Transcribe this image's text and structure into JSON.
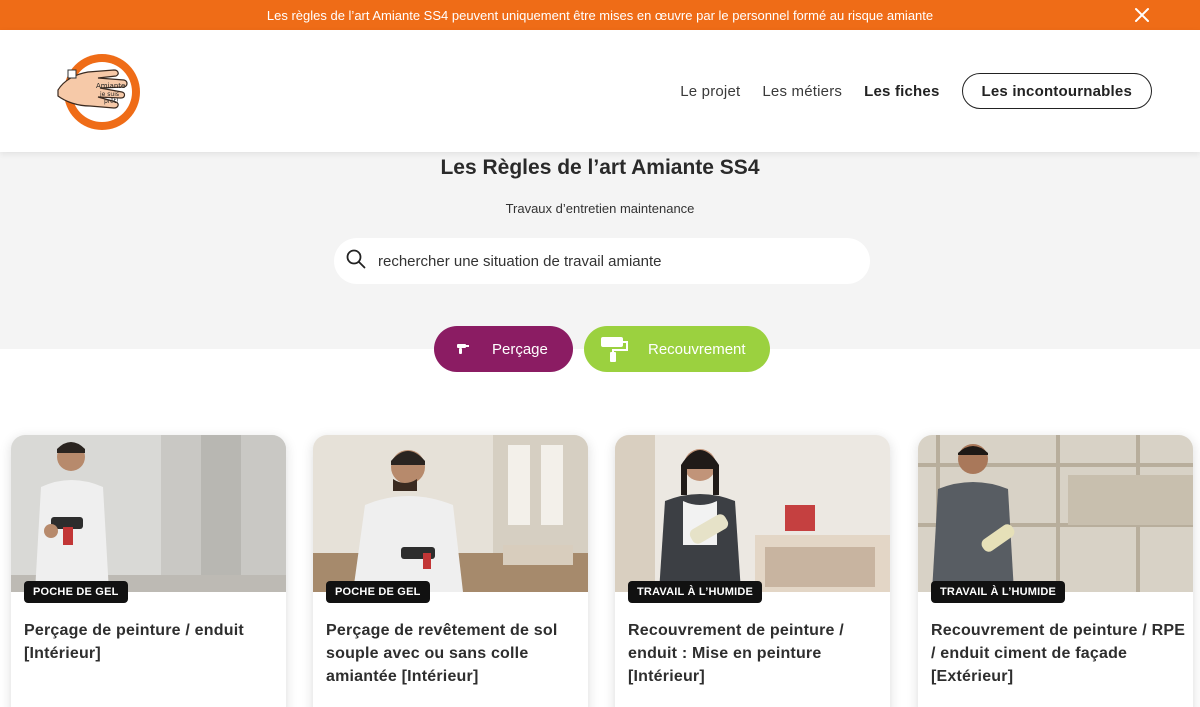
{
  "banner": {
    "text": "Les règles de l’art Amiante SS4 peuvent uniquement être mises en œuvre par le personnel formé au risque amiante",
    "close_icon": "close-icon",
    "color": "#ef6c17"
  },
  "header": {
    "logo_icon": "hand-logo-icon",
    "nav": {
      "projet": "Le projet",
      "metiers": "Les métiers",
      "fiches": "Les fiches",
      "incontournables": "Les incontournables"
    }
  },
  "hero": {
    "title": "Les Règles de l’art Amiante SS4",
    "subtitle": "Travaux d’entretien maintenance",
    "search_placeholder": "rechercher une situation de travail amiante",
    "search_icon": "search-icon"
  },
  "filters": [
    {
      "label": "Perçage",
      "icon": "drill-icon",
      "color": "#8b1c63"
    },
    {
      "label": "Recouvrement",
      "icon": "paint-roller-icon",
      "color": "#9bd13f"
    }
  ],
  "cards": [
    {
      "tag": "POCHE DE GEL",
      "title": "Perçage de peinture / enduit [Intérieur]"
    },
    {
      "tag": "POCHE DE GEL",
      "title": "Perçage de revêtement de sol souple avec ou sans colle amiantée [Intérieur]"
    },
    {
      "tag": "TRAVAIL À L’HUMIDE",
      "title": "Recouvrement de peinture / enduit : Mise en peinture [Intérieur]"
    },
    {
      "tag": "TRAVAIL À L’HUMIDE",
      "title": "Recouvrement de peinture / RPE / enduit ciment de façade [Extérieur]"
    }
  ]
}
